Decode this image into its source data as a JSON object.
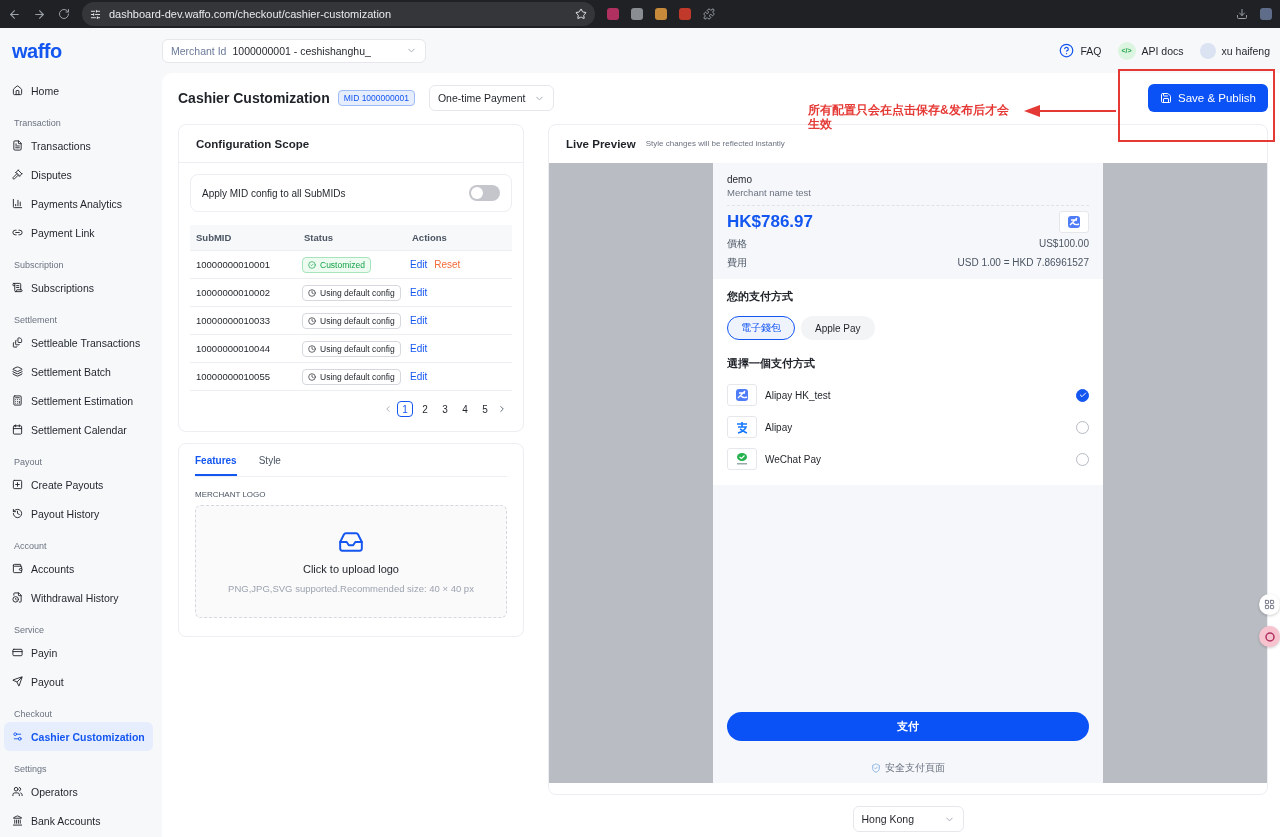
{
  "browser": {
    "url": "dashboard-dev.waffo.com/checkout/cashier-customization"
  },
  "sidebar": {
    "logo": "waffo",
    "groups": [
      {
        "items": [
          {
            "label": "Home",
            "selected": false
          }
        ]
      },
      {
        "label": "Transaction",
        "items": [
          {
            "label": "Transactions",
            "selected": false
          },
          {
            "label": "Disputes",
            "selected": false
          },
          {
            "label": "Payments Analytics",
            "selected": false
          },
          {
            "label": "Payment Link",
            "selected": false
          }
        ]
      },
      {
        "label": "Subscription",
        "items": [
          {
            "label": "Subscriptions",
            "selected": false
          }
        ]
      },
      {
        "label": "Settlement",
        "items": [
          {
            "label": "Settleable Transactions",
            "selected": false
          },
          {
            "label": "Settlement Batch",
            "selected": false
          },
          {
            "label": "Settlement Estimation",
            "selected": false
          },
          {
            "label": "Settlement Calendar",
            "selected": false
          }
        ]
      },
      {
        "label": "Payout",
        "items": [
          {
            "label": "Create Payouts",
            "selected": false
          },
          {
            "label": "Payout History",
            "selected": false
          }
        ]
      },
      {
        "label": "Account",
        "items": [
          {
            "label": "Accounts",
            "selected": false
          },
          {
            "label": "Withdrawal History",
            "selected": false
          }
        ]
      },
      {
        "label": "Service",
        "items": [
          {
            "label": "Payin",
            "selected": false
          },
          {
            "label": "Payout",
            "selected": false
          }
        ]
      },
      {
        "label": "Checkout",
        "items": [
          {
            "label": "Cashier Customization",
            "selected": true
          }
        ]
      },
      {
        "label": "Settings",
        "items": [
          {
            "label": "Operators",
            "selected": false
          },
          {
            "label": "Bank Accounts",
            "selected": false
          }
        ]
      }
    ]
  },
  "header": {
    "merchant_select": {
      "label": "Merchant Id",
      "value": "1000000001 - ceshishanghu_"
    },
    "faq": "FAQ",
    "api_docs_glyph": "</>",
    "api_docs": "API docs",
    "user": "xu haifeng"
  },
  "page": {
    "title": "Cashier Customization",
    "mid_badge": "MID 1000000001",
    "payment_type": "One-time Payment",
    "save_button": "Save & Publish"
  },
  "annotation": {
    "text": "所有配置只会在点击保存&发布后才会生效"
  },
  "config_scope": {
    "title": "Configuration Scope",
    "toggle": {
      "label": "Apply MID config to all SubMIDs",
      "on": false
    },
    "columns": [
      "SubMID",
      "Status",
      "Actions"
    ],
    "rows": [
      {
        "submid": "10000000010001",
        "status": {
          "kind": "customized",
          "label": "Customized"
        },
        "actions": [
          {
            "kind": "edit",
            "label": "Edit"
          },
          {
            "kind": "reset",
            "label": "Reset"
          }
        ]
      },
      {
        "submid": "10000000010002",
        "status": {
          "kind": "default",
          "label": "Using default config"
        },
        "actions": [
          {
            "kind": "edit",
            "label": "Edit"
          }
        ]
      },
      {
        "submid": "10000000010033",
        "status": {
          "kind": "default",
          "label": "Using default config"
        },
        "actions": [
          {
            "kind": "edit",
            "label": "Edit"
          }
        ]
      },
      {
        "submid": "10000000010044",
        "status": {
          "kind": "default",
          "label": "Using default config"
        },
        "actions": [
          {
            "kind": "edit",
            "label": "Edit"
          }
        ]
      },
      {
        "submid": "10000000010055",
        "status": {
          "kind": "default",
          "label": "Using default config"
        },
        "actions": [
          {
            "kind": "edit",
            "label": "Edit"
          }
        ]
      }
    ],
    "pages": [
      {
        "label": "1",
        "selected": true
      },
      {
        "label": "2",
        "selected": false
      },
      {
        "label": "3",
        "selected": false
      },
      {
        "label": "4",
        "selected": false
      },
      {
        "label": "5",
        "selected": false
      }
    ]
  },
  "features": {
    "tabs": [
      {
        "label": "Features",
        "selected": true
      },
      {
        "label": "Style",
        "selected": false
      }
    ],
    "section_label": "MERCHANT LOGO",
    "upload": {
      "title": "Click to upload logo",
      "hint": "PNG,JPG,SVG supported.Recommended size: 40 × 40 px"
    }
  },
  "preview": {
    "title": "Live Preview",
    "subtitle": "Style changes will be reflected instantly",
    "checkout": {
      "merchant_label": "demo",
      "merchant_name": "Merchant name test",
      "amount": "HK$786.97",
      "price_label": "價格",
      "price_value": "US$100.00",
      "fee_label": "費用",
      "fee_value": "USD 1.00 = HKD 7.86961527",
      "methods_title": "您的支付方式",
      "method_tabs": [
        {
          "label": "電子錢包",
          "selected": true
        },
        {
          "label": "Apple Pay",
          "selected": false
        }
      ],
      "choose_title": "選擇一個支付方式",
      "methods": [
        {
          "kind": "alipayhk",
          "name": "Alipay HK_test",
          "selected": true
        },
        {
          "kind": "alipay",
          "name": "Alipay",
          "selected": false
        },
        {
          "kind": "wechat",
          "name": "WeChat Pay",
          "selected": false
        }
      ],
      "pay_button": "支付",
      "secure_note": "安全支付頁面"
    },
    "region": "Hong Kong"
  }
}
